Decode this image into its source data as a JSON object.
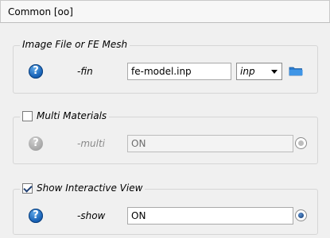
{
  "header": {
    "title": "Common   [oo]"
  },
  "groups": [
    {
      "legend": "Image File or FE Mesh",
      "param_label": "-fin",
      "value": "fe-model.inp",
      "format_options_selected": "inp",
      "icons": {
        "help": "help-icon",
        "browse": "folder-icon"
      }
    },
    {
      "legend": "Multi Materials",
      "checked": false,
      "param_label": "-multi",
      "value": "ON",
      "icons": {
        "help": "help-icon",
        "radio": "radio-button"
      }
    },
    {
      "legend": "Show Interactive View",
      "checked": true,
      "param_label": "-show",
      "value": "ON",
      "icons": {
        "help": "help-icon",
        "radio": "radio-button"
      }
    }
  ],
  "colors": {
    "accent_blue": "#1a64b8",
    "disabled_gray": "#a6a6a6"
  }
}
